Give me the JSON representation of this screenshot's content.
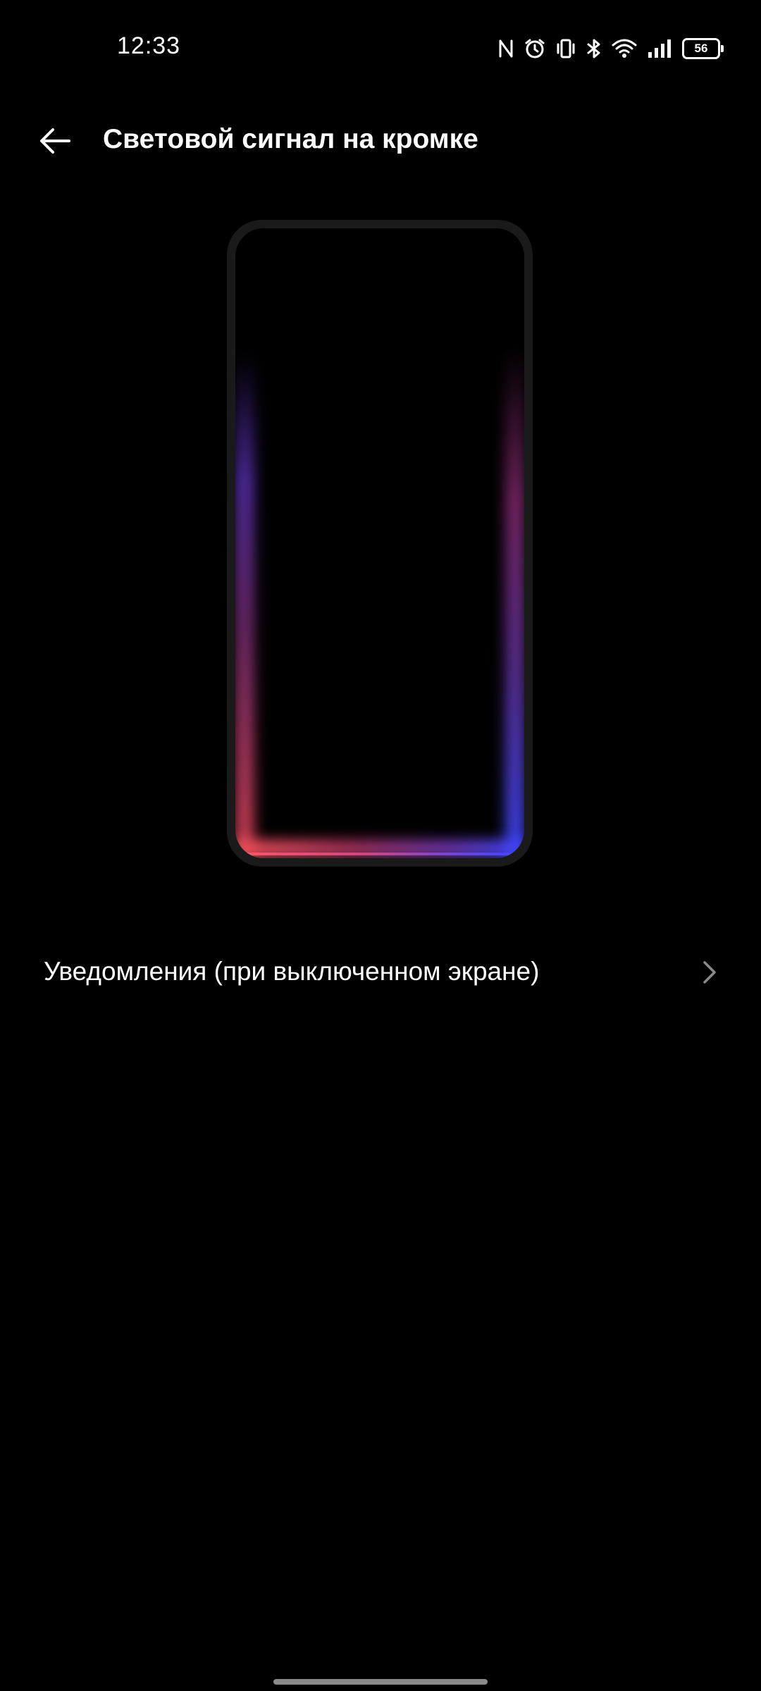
{
  "status_bar": {
    "time": "12:33",
    "battery_level": "56",
    "icons": [
      "nfc-icon",
      "alarm-icon",
      "vibrate-icon",
      "bluetooth-icon",
      "wifi-icon",
      "signal-icon",
      "battery-icon"
    ]
  },
  "header": {
    "title": "Световой сигнал на кромке",
    "back_icon": "arrow-left-icon"
  },
  "preview": {
    "glow_colors": [
      "#ff5a6a",
      "#c04ca0",
      "#6a48e0",
      "#3a48ff"
    ]
  },
  "settings": {
    "items": [
      {
        "label": "Уведомления (при выключенном экране)",
        "icon": "chevron-right-icon"
      }
    ]
  },
  "colors": {
    "background": "#000000",
    "text": "#ffffff",
    "chevron": "#8a8a8a"
  }
}
